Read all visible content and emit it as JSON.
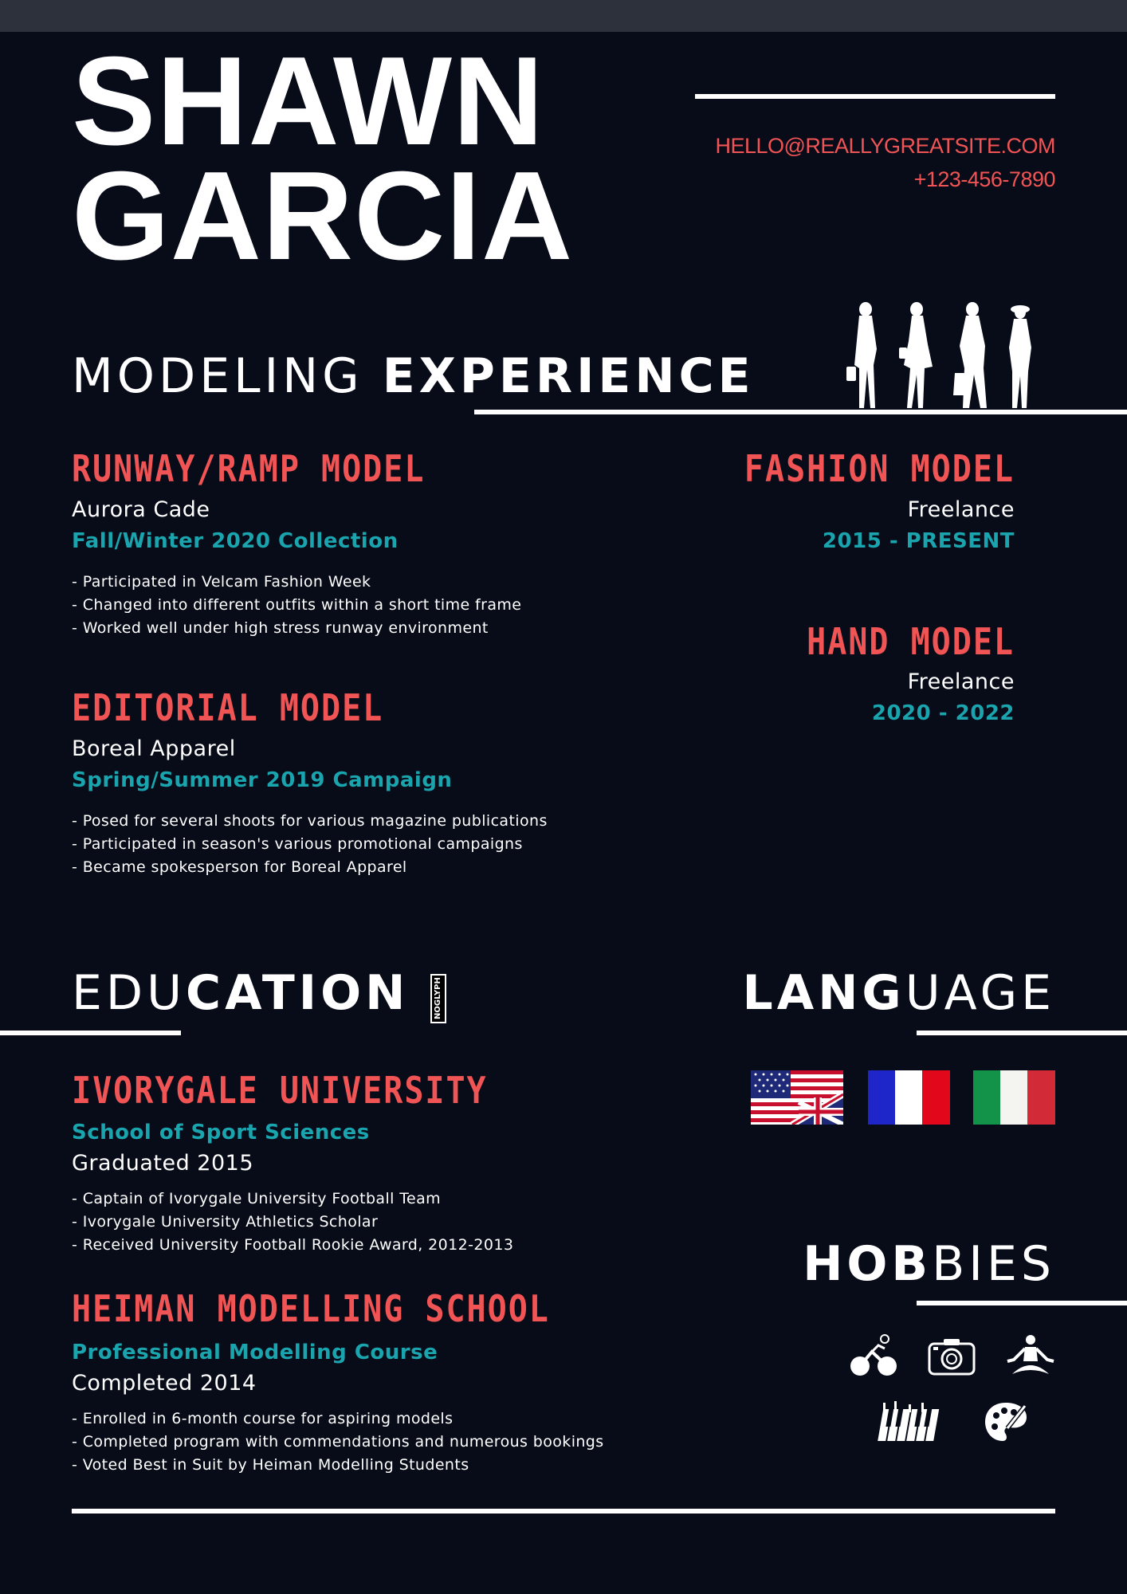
{
  "header": {
    "first_name": "SHAWN",
    "last_name": "GARCIA",
    "email": "HELLO@REALLYGREATSITE.COM",
    "phone": "+123-456-7890"
  },
  "experience": {
    "title_light": "MODELING ",
    "title_bold": "EXPERIENCE",
    "jobs_left": [
      {
        "title": "RUNWAY/RAMP MODEL",
        "org": "Aurora Cade",
        "period": "Fall/Winter 2020 Collection",
        "bullets": [
          "- Participated in Velcam Fashion Week",
          "- Changed into different outfits within a short time frame",
          "- Worked well under high stress runway environment"
        ]
      },
      {
        "title": "EDITORIAL MODEL",
        "org": "Boreal Apparel",
        "period": "Spring/Summer 2019 Campaign",
        "bullets": [
          "- Posed for several shoots for various magazine publications",
          "- Participated in season's various promotional campaigns",
          "- Became spokesperson for Boreal Apparel"
        ]
      }
    ],
    "jobs_right": [
      {
        "title": "FASHION MODEL",
        "org": "Freelance",
        "period": "2015 - PRESENT"
      },
      {
        "title": "HAND MODEL",
        "org": "Freelance",
        "period": "2020 - 2022"
      }
    ]
  },
  "education": {
    "title_light": "EDU",
    "title_bold": "CATION",
    "watermark": "NOGLYPH",
    "schools": [
      {
        "name": "IVORYGALE UNIVERSITY",
        "program": "School of Sport Sciences",
        "status": "Graduated 2015",
        "bullets": [
          "- Captain of Ivorygale University Football Team",
          "- Ivorygale University Athletics Scholar",
          "- Received University Football Rookie Award, 2012-2013"
        ]
      },
      {
        "name": "HEIMAN MODELLING SCHOOL",
        "program": "Professional Modelling Course",
        "status": "Completed 2014",
        "bullets": [
          "- Enrolled in 6-month course for aspiring models",
          "- Completed program with commendations and numerous bookings",
          "- Voted Best in Suit by Heiman Modelling Students"
        ]
      }
    ]
  },
  "language": {
    "title_bold": "LANG",
    "title_light": "UAGE",
    "flags": [
      "us-uk-flag",
      "france-flag",
      "italy-flag"
    ]
  },
  "hobbies": {
    "title_bold": "HOB",
    "title_light": "BIES",
    "icons": [
      "cycling-icon",
      "camera-icon",
      "yoga-icon",
      "piano-icon",
      "paint-palette-icon"
    ]
  },
  "colors": {
    "background": "#080b18",
    "accent_red": "#f05454",
    "accent_teal": "#1aa4ae",
    "text": "#ffffff"
  }
}
